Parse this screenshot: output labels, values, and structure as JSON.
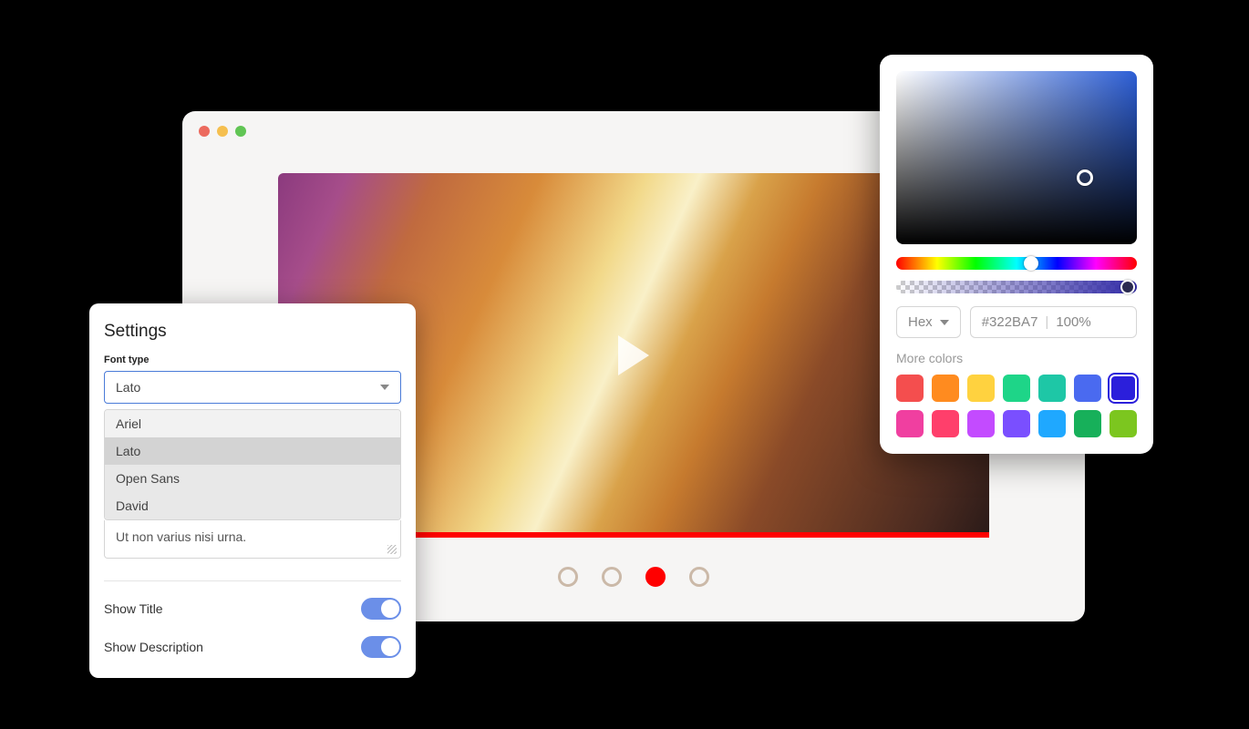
{
  "browser": {
    "pager": {
      "count": 4,
      "active_index": 2
    }
  },
  "settings": {
    "title": "Settings",
    "font_type_label": "Font type",
    "font_selected": "Lato",
    "font_options": [
      "Ariel",
      "Lato",
      "Open Sans",
      "David"
    ],
    "textarea_value": "Ut non varius nisi urna.",
    "show_title_label": "Show Title",
    "show_title_on": true,
    "show_description_label": "Show Description",
    "show_description_on": true
  },
  "color_picker": {
    "format_label": "Hex",
    "hex_value": "#322BA7",
    "opacity": "100%",
    "more_colors_label": "More colors",
    "swatches": [
      {
        "color": "#f44e4e",
        "selected": false
      },
      {
        "color": "#ff8b1f",
        "selected": false
      },
      {
        "color": "#ffd23f",
        "selected": false
      },
      {
        "color": "#1ed588",
        "selected": false
      },
      {
        "color": "#1ec7a6",
        "selected": false
      },
      {
        "color": "#4a6af0",
        "selected": false
      },
      {
        "color": "#2b1fdb",
        "selected": true
      },
      {
        "color": "#f03fa0",
        "selected": false
      },
      {
        "color": "#ff3f6b",
        "selected": false
      },
      {
        "color": "#c34bff",
        "selected": false
      },
      {
        "color": "#7a4fff",
        "selected": false
      },
      {
        "color": "#1fa8ff",
        "selected": false
      },
      {
        "color": "#17b05a",
        "selected": false
      },
      {
        "color": "#7cc61f",
        "selected": false
      }
    ]
  }
}
